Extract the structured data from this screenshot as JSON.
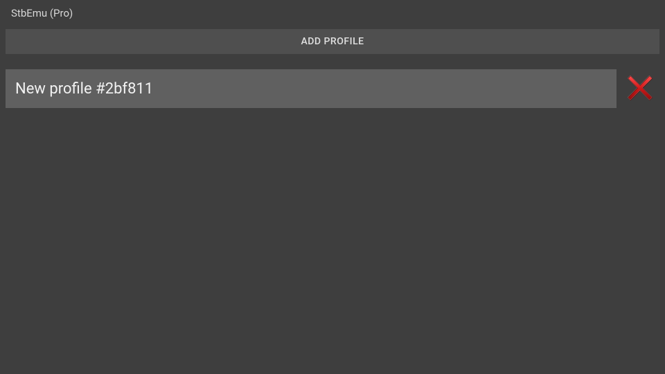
{
  "app_title": "StbEmu (Pro)",
  "add_profile_label": "ADD PROFILE",
  "profiles": [
    {
      "name": "New profile #2bf811"
    }
  ]
}
